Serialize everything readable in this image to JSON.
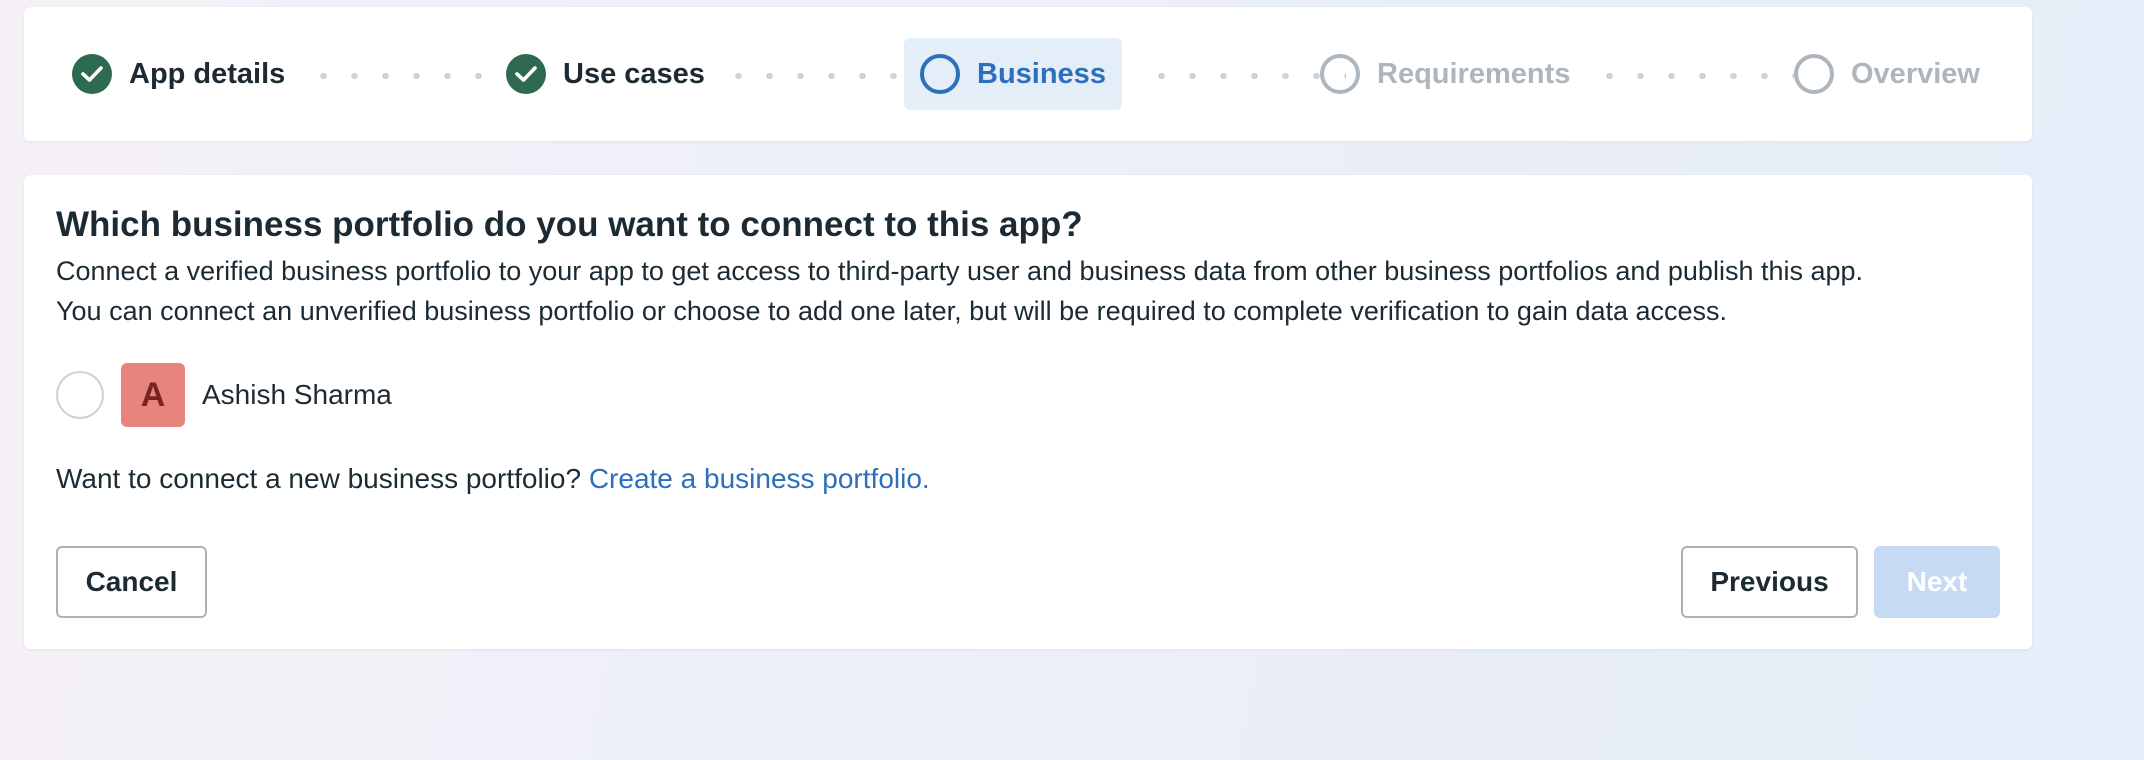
{
  "stepper": {
    "steps": [
      {
        "label": "App details",
        "state": "completed"
      },
      {
        "label": "Use cases",
        "state": "completed"
      },
      {
        "label": "Business",
        "state": "current"
      },
      {
        "label": "Requirements",
        "state": "upcoming"
      },
      {
        "label": "Overview",
        "state": "upcoming"
      }
    ]
  },
  "business": {
    "title": "Which business portfolio do you want to connect to this app?",
    "description_line1": "Connect a verified business portfolio to your app to get access to third-party user and business data from other business portfolios and publish this app.",
    "description_line2": "You can connect an unverified business portfolio or choose to add one later, but will be required to complete verification to gain data access.",
    "option": {
      "avatar_letter": "A",
      "name": "Ashish Sharma",
      "selected": false
    },
    "new_portfolio_prompt": "Want to connect a new business portfolio?",
    "new_portfolio_link": "Create a business portfolio."
  },
  "actions": {
    "cancel": "Cancel",
    "previous": "Previous",
    "next": "Next",
    "next_disabled": true
  },
  "colors": {
    "completed": "#2d6a4f",
    "accent": "#2c6fbb",
    "current_bg": "#e3eef8",
    "upcoming": "#aeb6bd",
    "avatar_bg": "#e8847c",
    "next_disabled_bg": "#c6dbf3"
  },
  "icons": {
    "completed_step": "check-circle-icon",
    "current_step": "ring-icon",
    "upcoming_step": "ring-icon"
  }
}
